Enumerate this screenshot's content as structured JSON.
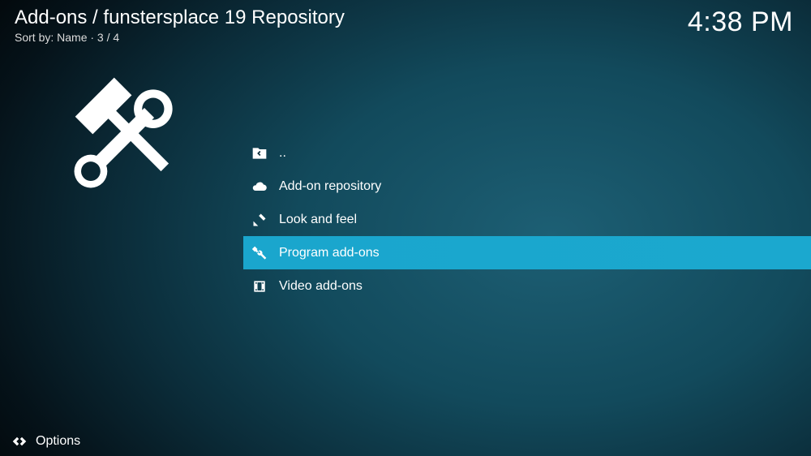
{
  "header": {
    "breadcrumb": "Add-ons / funstersplace 19 Repository",
    "sort_label": "Sort by: Name  ·  3 / 4",
    "clock": "4:38 PM"
  },
  "list": {
    "items": [
      {
        "icon": "folder-back-icon",
        "label": ".."
      },
      {
        "icon": "cloud-icon",
        "label": "Add-on repository"
      },
      {
        "icon": "skin-icon",
        "label": "Look and feel"
      },
      {
        "icon": "tools-icon",
        "label": "Program add-ons",
        "selected": true
      },
      {
        "icon": "film-icon",
        "label": "Video add-ons"
      }
    ]
  },
  "footer": {
    "options_label": "Options"
  }
}
